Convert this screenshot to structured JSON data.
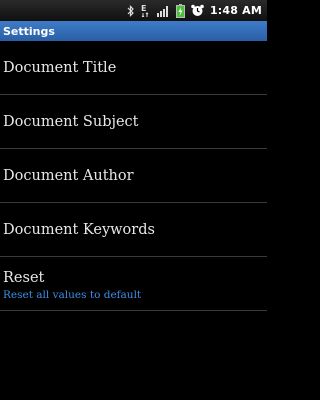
{
  "status_bar": {
    "icons": [
      "bluetooth-icon",
      "data-transfer-icon",
      "signal-bars-icon",
      "battery-icon",
      "alarm-clock-icon"
    ],
    "data_label": "E",
    "time": "1:48 AM",
    "battery_color": "#4cc23a"
  },
  "title_bar": {
    "title": "Settings",
    "color": "#3a73bf"
  },
  "settings": {
    "items": [
      {
        "label": "Document Title"
      },
      {
        "label": "Document Subject"
      },
      {
        "label": "Document Author"
      },
      {
        "label": "Document Keywords"
      },
      {
        "label": "Reset",
        "summary": "Reset all values to default"
      }
    ],
    "summary_color": "#3d8ee6"
  }
}
